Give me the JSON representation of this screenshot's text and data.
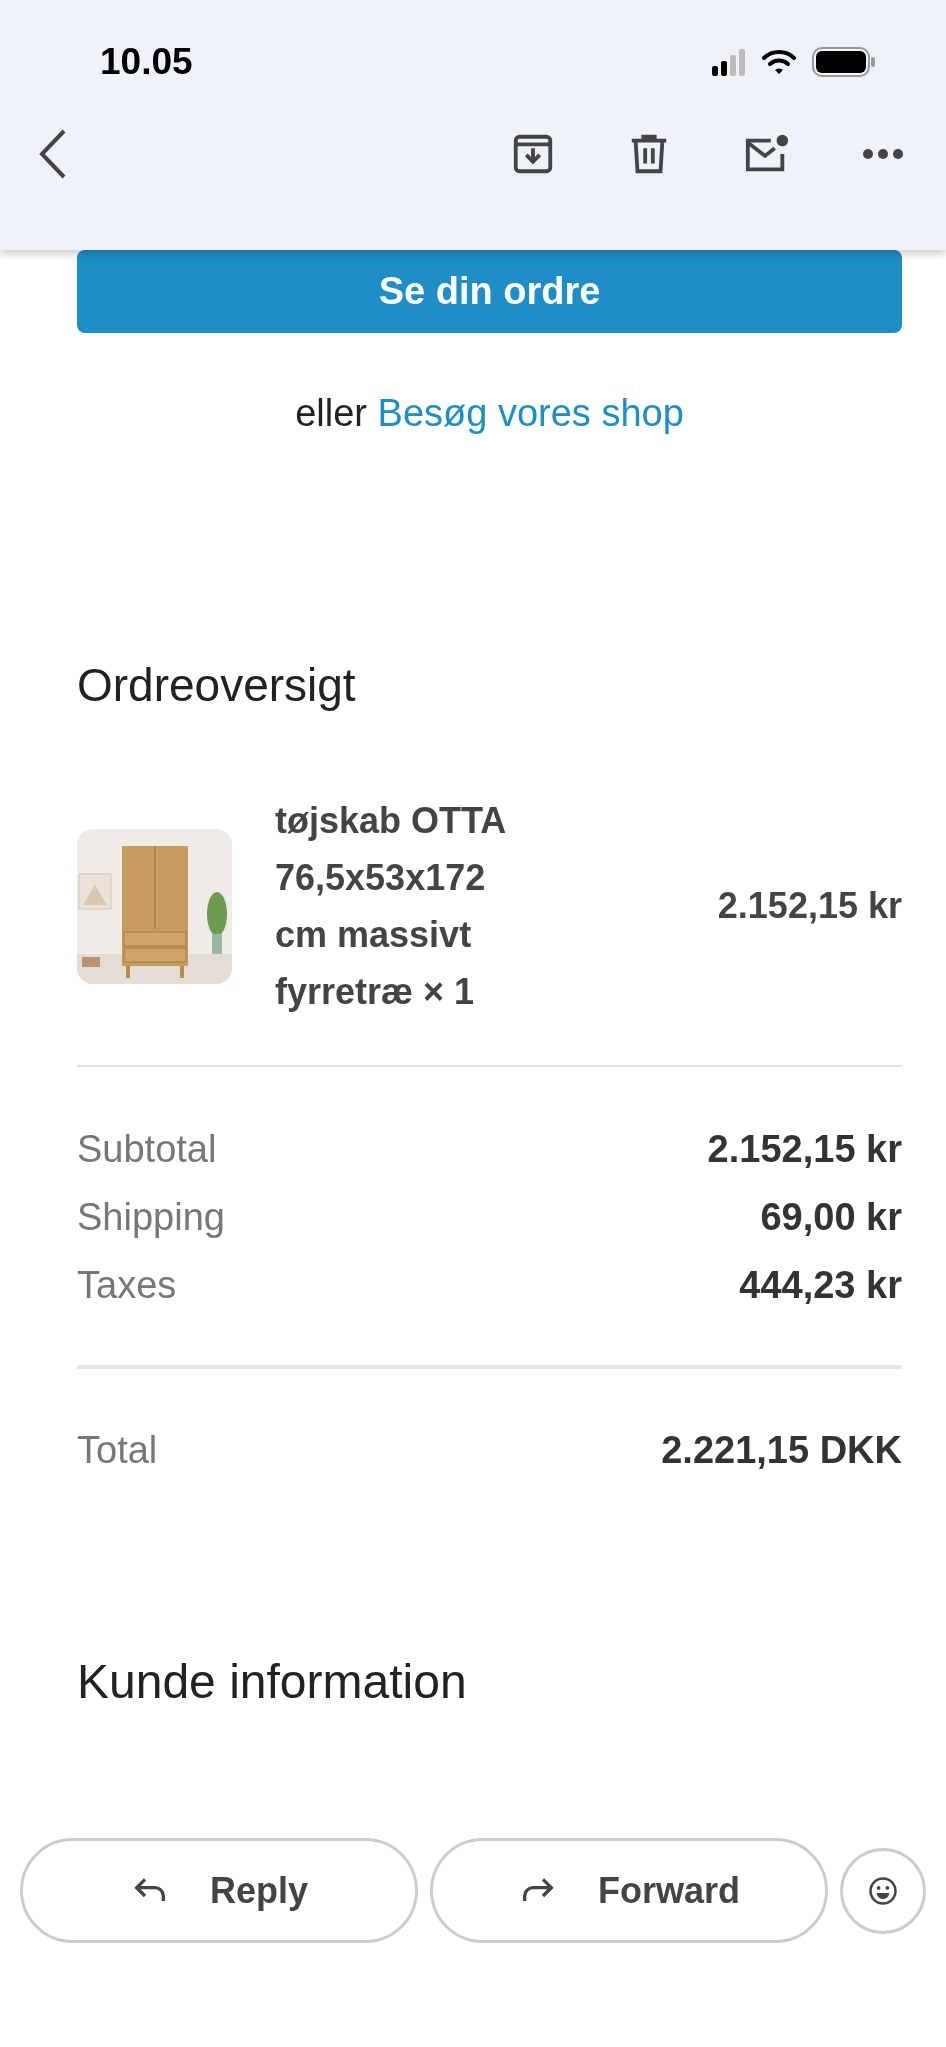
{
  "status_bar": {
    "time": "10.05"
  },
  "email": {
    "button": "Se din ordre",
    "alternative": {
      "prefix": "eller",
      "link": "Besøg vores shop"
    },
    "order_summary": {
      "title": "Ordreoversigt",
      "items": [
        {
          "kind": "picture",
          "name": "tøjskab OTTA 76,5x53x172 cm massivt fyrretræ × 1",
          "price": "2.152,15 kr"
        }
      ],
      "lines": [
        {
          "label": "Subtotal",
          "value": "2.152,15 kr"
        },
        {
          "label": "Shipping",
          "value": "69,00 kr"
        },
        {
          "label": "Taxes",
          "value": "444,23 kr"
        }
      ],
      "total": {
        "label": "Total",
        "value": "2.221,15 DKK"
      }
    },
    "customer": {
      "title": "Kunde information"
    }
  },
  "actions": [
    {
      "kind": "reply",
      "label": "Reply"
    },
    {
      "kind": "forward",
      "label": "Forward"
    }
  ]
}
